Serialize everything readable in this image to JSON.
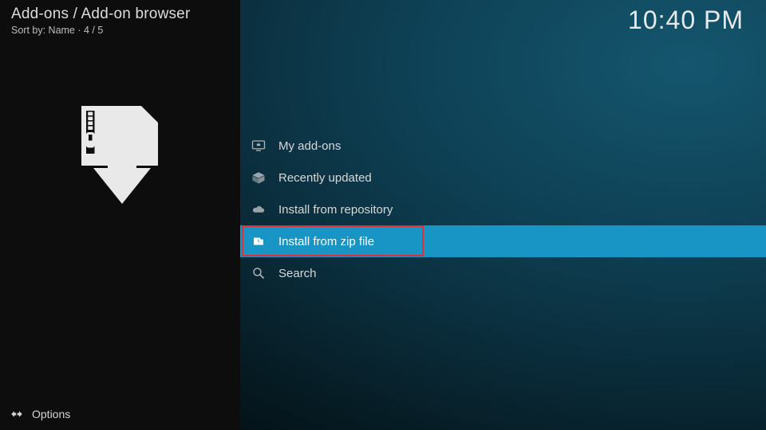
{
  "header": {
    "breadcrumb": "Add-ons / Add-on browser",
    "sort_line": "Sort by: Name  ·  4 / 5",
    "clock": "10:40 PM"
  },
  "menu": {
    "items": [
      {
        "label": "My add-ons",
        "icon": "display-addons-icon",
        "selected": false
      },
      {
        "label": "Recently updated",
        "icon": "box-open-icon",
        "selected": false
      },
      {
        "label": "Install from repository",
        "icon": "cloud-download-icon",
        "selected": false
      },
      {
        "label": "Install from zip file",
        "icon": "zip-file-icon",
        "selected": true
      },
      {
        "label": "Search",
        "icon": "search-icon",
        "selected": false
      }
    ]
  },
  "footer": {
    "options_label": "Options",
    "options_icon": "slider-arrows-icon"
  },
  "side_art_icon": "zip-download-icon"
}
